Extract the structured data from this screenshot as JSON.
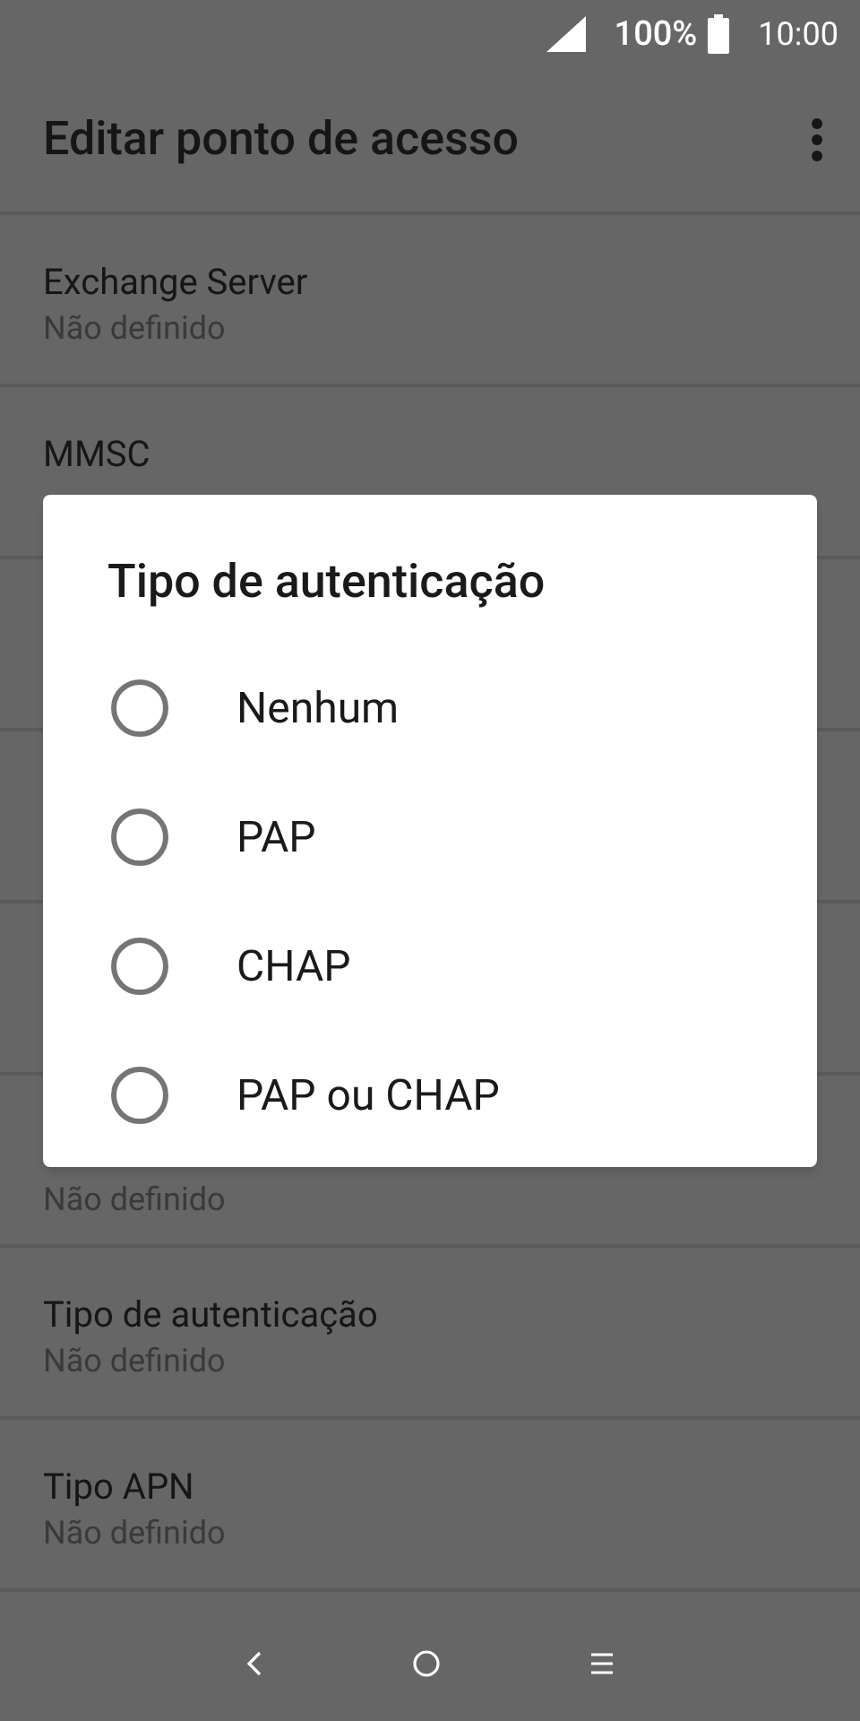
{
  "status_bar": {
    "battery": "100%",
    "time": "10:00"
  },
  "app_bar": {
    "title": "Editar ponto de acesso"
  },
  "settings_top": [
    {
      "title": "Exchange Server",
      "subtitle": "Não definido"
    },
    {
      "title": "MMSC"
    }
  ],
  "settings_bottom": [
    {
      "subtitle": "Não definido"
    },
    {
      "title": "Tipo de autenticação",
      "subtitle": "Não definido"
    },
    {
      "title": "Tipo APN",
      "subtitle": "Não definido"
    }
  ],
  "dialog": {
    "title": "Tipo de autenticação",
    "options": [
      {
        "label": "Nenhum",
        "selected": false
      },
      {
        "label": "PAP",
        "selected": false
      },
      {
        "label": "CHAP",
        "selected": false
      },
      {
        "label": "PAP ou CHAP",
        "selected": false
      }
    ]
  }
}
